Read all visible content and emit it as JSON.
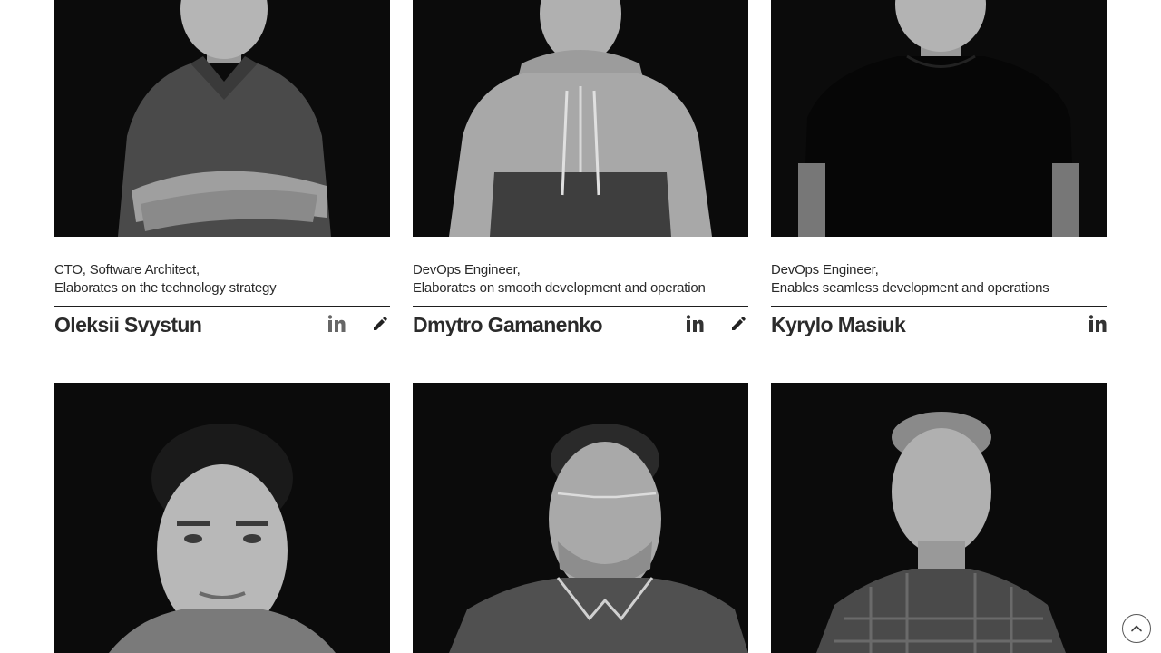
{
  "team": [
    {
      "role_line1": "CTO, Software Architect,",
      "role_line2": "Elaborates on the technology strategy",
      "name": "Oleksii Svystun",
      "icons": [
        "linkedin-icon",
        "pencil-icon"
      ]
    },
    {
      "role_line1": "DevOps Engineer,",
      "role_line2": "Elaborates on smooth development and operation",
      "name": "Dmytro Gamanenko",
      "icons": [
        "linkedin-icon",
        "pencil-icon"
      ]
    },
    {
      "role_line1": "DevOps Engineer,",
      "role_line2": "Enables seamless development and operations",
      "name": "Kyrylo Masiuk",
      "icons": [
        "linkedin-icon"
      ]
    }
  ],
  "icons": {
    "linkedin": "linkedin-icon",
    "edit": "pencil-icon",
    "scroll_top": "chevron-up-icon"
  },
  "colors": {
    "photo_background": "#0b0b0b",
    "text": "#222222",
    "icon": "#3a3a3a"
  }
}
